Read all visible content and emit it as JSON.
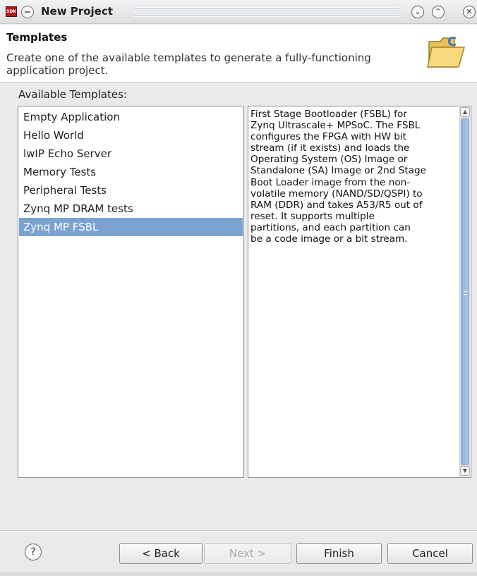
{
  "window": {
    "title": "New Project",
    "app_badge": "SDK",
    "controls": [
      "minimize",
      "maximize",
      "close"
    ]
  },
  "header": {
    "title": "Templates",
    "description": "Create one of the available templates to generate a fully-functioning application project."
  },
  "templates_label": "Available Templates:",
  "templates": [
    {
      "label": "Empty Application"
    },
    {
      "label": "Hello World"
    },
    {
      "label": "lwIP Echo Server"
    },
    {
      "label": "Memory Tests"
    },
    {
      "label": "Peripheral Tests"
    },
    {
      "label": "Zynq MP DRAM tests"
    },
    {
      "label": "Zynq MP FSBL",
      "selected": true
    }
  ],
  "selected_template_index": 6,
  "description_lines": [
    "First Stage Bootloader (FSBL) for",
    "Zynq Ultrascale+ MPSoC. The FSBL",
    "configures the FPGA with HW bit",
    "stream (if it exists)  and loads the",
    "Operating System (OS) Image or",
    "Standalone (SA) Image or 2nd Stage",
    "Boot Loader image from the  non-",
    "volatile memory (NAND/SD/QSPI) to",
    "RAM (DDR) and takes A53/R5 out of",
    "reset.  It supports multiple",
    "partitions, and each partition can",
    "be a code image or a bit stream."
  ],
  "buttons": {
    "help": "?",
    "back": "< Back",
    "next": "Next >",
    "finish": "Finish",
    "cancel": "Cancel"
  },
  "button_states": {
    "next_enabled": false
  },
  "colors": {
    "selection": "#7aa3d4",
    "scroll_thumb": "#8fb3dc",
    "app_badge": "#b01818"
  },
  "icons": {
    "window_menu": "circle-menu-icon",
    "minimize": "chevron-down-icon",
    "maximize": "chevron-up-icon",
    "close": "close-icon",
    "header": "folder-open-icon",
    "help": "help-icon"
  }
}
